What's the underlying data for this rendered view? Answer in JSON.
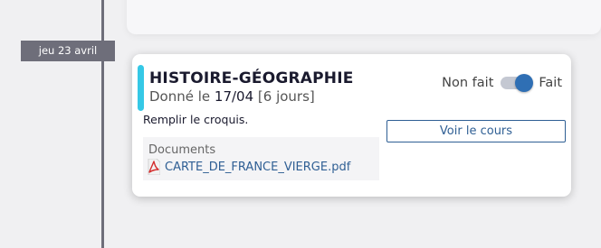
{
  "timeline": {
    "date_label": "jeu 23 avril"
  },
  "homework": {
    "subject": "HISTOIRE-GÉOGRAPHIE",
    "given_prefix": "Donné le ",
    "given_date": "17/04",
    "given_duration": " [6 jours]",
    "accent_color": "#35c8e6",
    "status_off_label": "Non fait",
    "status_on_label": "Fait",
    "status_done": true,
    "task": "Remplir le croquis.",
    "course_button_label": "Voir le cours",
    "documents_title": "Documents",
    "documents": [
      {
        "name": "CARTE_DE_FRANCE_VIERGE.pdf",
        "icon": "pdf-icon"
      }
    ]
  }
}
